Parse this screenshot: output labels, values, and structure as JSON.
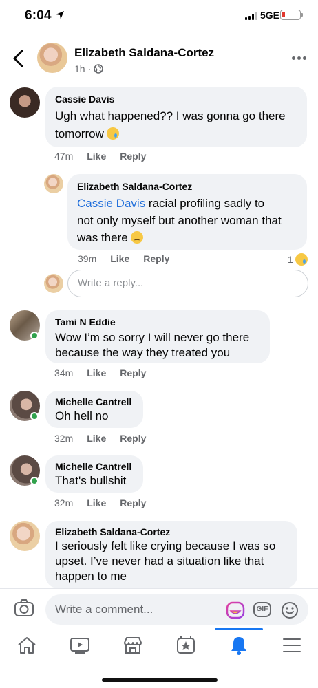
{
  "status_bar": {
    "time": "6:04",
    "network": "5GE"
  },
  "header": {
    "name": "Elizabeth Saldana-Cortez",
    "time": "1h ·"
  },
  "comments": [
    {
      "name": "Cassie Davis",
      "text": "Ugh what happened?? I was gonna go there tomorrow",
      "emoji": "crying-face",
      "time": "47m",
      "like": "Like",
      "reply": "Reply"
    },
    {
      "name": "Elizabeth Saldana-Cortez",
      "mention": "Cassie Davis",
      "text_line1": " racial profiling sadly to",
      "text_line2": "not only myself but another woman that",
      "text_line3": "was there",
      "emoji": "disappointed-face",
      "time": "39m",
      "like": "Like",
      "reply": "Reply",
      "reaction_count": "1",
      "reaction_emoji": "crying-face"
    },
    {
      "name": "Tami N Eddie",
      "text": "Wow I’m so sorry I will never go there because the way they treated you",
      "time": "34m",
      "like": "Like",
      "reply": "Reply",
      "online": true
    },
    {
      "name": "Michelle Cantrell",
      "text": "Oh hell no",
      "time": "32m",
      "like": "Like",
      "reply": "Reply",
      "online": true
    },
    {
      "name": "Michelle Cantrell",
      "text": "That's bullshit",
      "time": "32m",
      "like": "Like",
      "reply": "Reply",
      "online": true
    },
    {
      "name": "Elizabeth Saldana-Cortez",
      "text": "I seriously felt like crying because I was so upset. I’ve never had a situation like that happen to me"
    }
  ],
  "reply_box": {
    "placeholder": "Write a reply..."
  },
  "composer": {
    "placeholder": "Write a comment...",
    "gif_label": "GIF"
  },
  "tabs": [
    "home",
    "watch",
    "marketplace",
    "favorites",
    "notifications",
    "menu"
  ],
  "colors": {
    "accent": "#1877f2",
    "online": "#31a24c",
    "mention": "#216fdb"
  }
}
